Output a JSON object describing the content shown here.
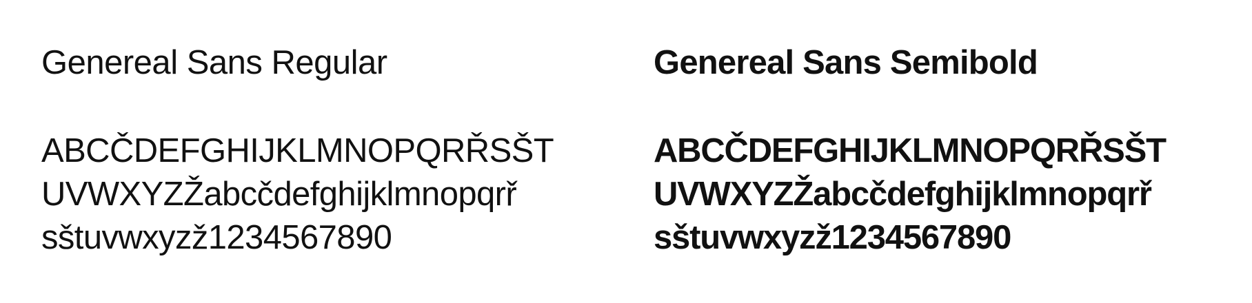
{
  "specimens": [
    {
      "title": "Genereal Sans Regular",
      "lines": [
        "ABCČDEFGHIJKLMNOPQRŘSŠT",
        "UVWXYZŽabcčdefghijklmnopqrř",
        "sštuvwxyzž1234567890"
      ]
    },
    {
      "title": "Genereal Sans Semibold",
      "lines": [
        "ABCČDEFGHIJKLMNOPQRŘSŠT",
        "UVWXYZŽabcčdefghijklmnopqrř",
        "sštuvwxyzž1234567890"
      ]
    }
  ]
}
